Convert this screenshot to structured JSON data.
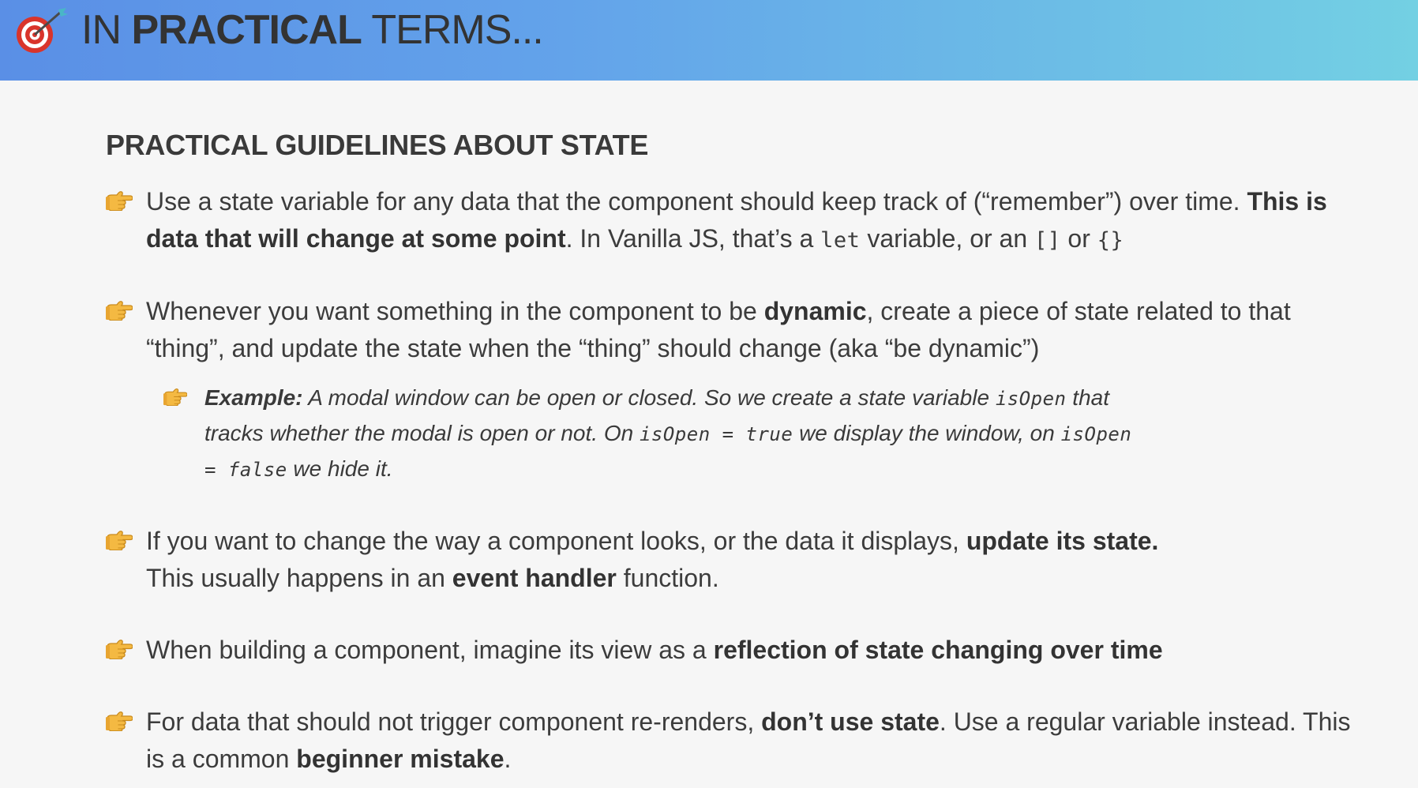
{
  "header": {
    "title_prefix": "IN ",
    "title_bold": "PRACTICAL",
    "title_suffix": " TERMS...",
    "icon": "target-dart-icon"
  },
  "heading": "PRACTICAL GUIDELINES ABOUT STATE",
  "bullets": {
    "b1": {
      "t1": "Use a state variable for any data that the component should keep track of (“remember”) over time. ",
      "bold1": "This is data that will change at some point",
      "t2": ". In Vanilla JS, that’s a ",
      "code1": "let",
      "t3": " variable, or an ",
      "code2": "[]",
      "t4": " or ",
      "code3": "{}"
    },
    "b2": {
      "t1": "Whenever you want something in the component to be ",
      "bold1": "dynamic",
      "t2": ", create a piece of state related to that “thing”, and update the state when the “thing” should change (aka “be dynamic”)"
    },
    "example": {
      "label": "Example:",
      "t1": " A modal window can be open or closed. So we create a state variable ",
      "code1": "isOpen",
      "t2": " that tracks whether the modal is open or not. On ",
      "code2": "isOpen = true",
      "t3": " we display the window, on ",
      "code3": "isOpen = false",
      "t4": " we hide it."
    },
    "b3": {
      "t1": "If you want to change the way a component looks, or the data it displays, ",
      "bold1": "update its state.",
      "t2": " This usually happens in an ",
      "bold2": "event handler",
      "t3": " function."
    },
    "b4": {
      "t1": "When building a component, imagine its view as a ",
      "bold1": "reflection of state changing over time"
    },
    "b5": {
      "t1": "For data that should not trigger component re-renders, ",
      "bold1": "don’t use state",
      "t2": ". Use a regular variable instead. This is a common ",
      "bold2": "beginner mistake",
      "t3": "."
    }
  },
  "colors": {
    "header_start": "#5a8fe6",
    "header_end": "#73d0e3",
    "background": "#f6f6f6",
    "bullet_hand": "#f2b63a"
  }
}
